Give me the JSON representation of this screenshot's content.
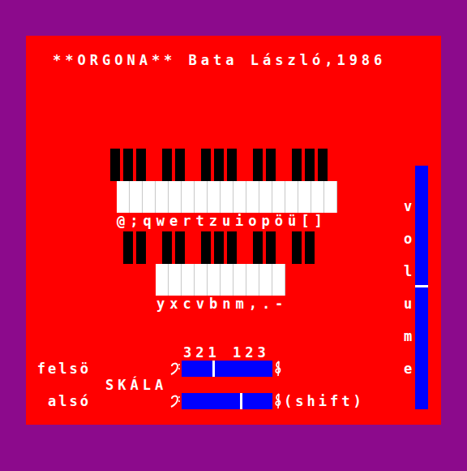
{
  "title": "**ORGONA** Bata László,1986",
  "keyboards": [
    {
      "name": "upper",
      "black_keys": [
        true,
        true,
        true,
        false,
        true,
        true,
        false,
        true,
        true,
        true,
        false,
        true,
        true,
        false,
        true,
        true,
        true
      ],
      "white_key_count": 17,
      "labels": "@;qwertzuiopöü[]"
    },
    {
      "name": "lower",
      "black_keys": [
        true,
        true,
        false,
        true,
        true,
        false,
        true,
        true,
        true,
        false,
        true,
        true,
        false,
        true,
        true
      ],
      "white_key_count": 10,
      "labels": "yxcvbnm,.-"
    }
  ],
  "scale": {
    "label": "SKÁLA",
    "numbers": "321 123",
    "rows": [
      {
        "label": "felsö",
        "level": 0.34,
        "suffix": ""
      },
      {
        "label": "alsó",
        "level": 0.64,
        "suffix": "(shift)"
      }
    ]
  },
  "volume": {
    "label": "volume",
    "level": 0.5
  }
}
